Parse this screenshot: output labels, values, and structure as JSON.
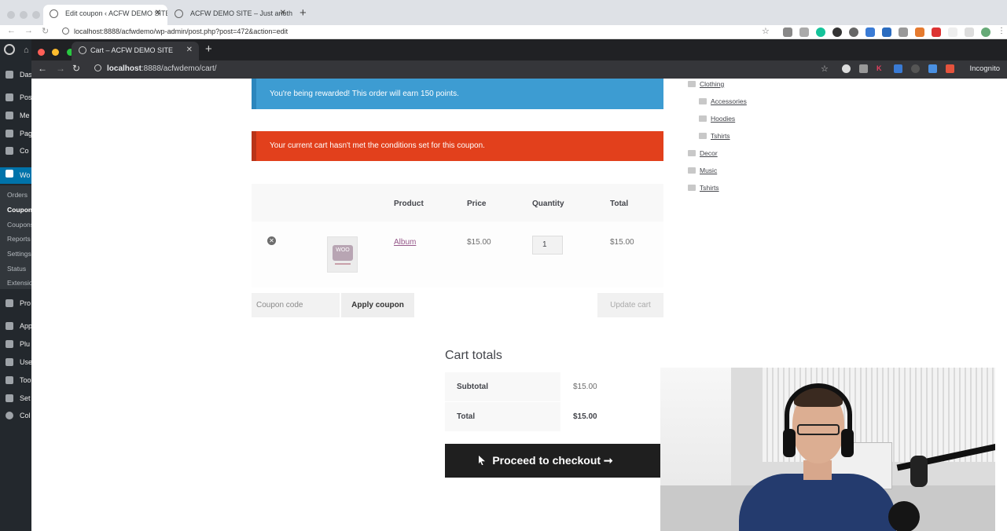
{
  "background_browser": {
    "tabs": [
      {
        "label": "Edit coupon ‹ ACFW DEMO SITE"
      },
      {
        "label": "ACFW DEMO SITE – Just anoth"
      }
    ],
    "url": "localhost:8888/acfwdemo/wp-admin/post.php?post=472&action=edit"
  },
  "wp_admin": {
    "menu": [
      {
        "label": "Das"
      },
      {
        "label": "Pos"
      },
      {
        "label": "Me"
      },
      {
        "label": "Pag"
      },
      {
        "label": "Co"
      },
      {
        "label": "Wo"
      },
      {
        "label": "Pro"
      },
      {
        "label": "App"
      },
      {
        "label": "Plu"
      },
      {
        "label": "Use"
      },
      {
        "label": "Too"
      },
      {
        "label": "Set"
      },
      {
        "label": "Col"
      }
    ],
    "submenu": [
      "Orders",
      "Coupons",
      "Coupons",
      "Reports",
      "Settings",
      "Status",
      "Extensions"
    ]
  },
  "window": {
    "tab_title": "Cart – ACFW DEMO SITE",
    "url_host": "localhost",
    "url_path": ":8888/acfwdemo/cart/",
    "incognito_label": "Incognito"
  },
  "notices": {
    "info": "You're being rewarded! This order will earn 150 points.",
    "error": "Your current cart hasn't met the conditions set for this coupon."
  },
  "cart": {
    "headers": {
      "product": "Product",
      "price": "Price",
      "quantity": "Quantity",
      "total": "Total"
    },
    "items": [
      {
        "name": "Album",
        "price": "$15.00",
        "quantity": "1",
        "total": "$15.00",
        "thumb_text": "WOO"
      }
    ],
    "coupon_placeholder": "Coupon code",
    "apply_label": "Apply coupon",
    "update_label": "Update cart"
  },
  "totals": {
    "title": "Cart totals",
    "subtotal_label": "Subtotal",
    "subtotal_value": "$15.00",
    "total_label": "Total",
    "total_value": "$15.00",
    "checkout_label": "Proceed to checkout ➞"
  },
  "categories": [
    {
      "label": "Clothing",
      "level": 0
    },
    {
      "label": "Accessories",
      "level": 1
    },
    {
      "label": "Hoodies",
      "level": 1
    },
    {
      "label": "Tshirts",
      "level": 1
    },
    {
      "label": "Decor",
      "level": 0
    },
    {
      "label": "Music",
      "level": 0
    },
    {
      "label": "Tshirts",
      "level": 0
    }
  ],
  "colors": {
    "info": "#3d9cd2",
    "error": "#e2401c",
    "wp_sidebar": "#23282d",
    "woo_active": "#0073aa",
    "link": "#96588a"
  }
}
